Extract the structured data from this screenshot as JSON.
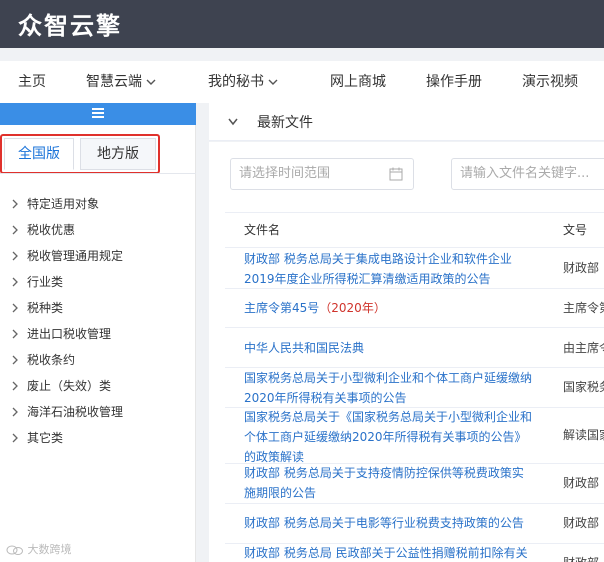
{
  "header": {
    "logo": "众智云擎"
  },
  "nav": {
    "items": [
      {
        "label": "主页"
      },
      {
        "label": "智慧云端"
      },
      {
        "label": "我的秘书"
      },
      {
        "label": "网上商城"
      },
      {
        "label": "操作手册"
      },
      {
        "label": "演示视频"
      }
    ]
  },
  "sidebar": {
    "tabs": [
      {
        "label": "全国版"
      },
      {
        "label": "地方版"
      }
    ],
    "tree": [
      {
        "label": "特定适用对象"
      },
      {
        "label": "税收优惠"
      },
      {
        "label": "税收管理通用规定"
      },
      {
        "label": "行业类"
      },
      {
        "label": "税种类"
      },
      {
        "label": "进出口税收管理"
      },
      {
        "label": "税收条约"
      },
      {
        "label": "废止（失效）类"
      },
      {
        "label": "海洋石油税收管理"
      },
      {
        "label": "其它类"
      }
    ]
  },
  "watermark": "大数跨境",
  "main": {
    "panel_title": "最新文件",
    "filters": {
      "date_placeholder": "请选择时间范围",
      "keyword_placeholder": "请输入文件名关键字..."
    },
    "table": {
      "columns": {
        "name": "文件名",
        "number": "文号"
      },
      "rows": [
        {
          "name": "财政部 税务总局关于集成电路设计企业和软件企业2019年度企业所得税汇算清缴适用政策的公告",
          "number": "财政部"
        },
        {
          "name": "主席令第45号",
          "name_suffix": "（2020年）",
          "number": "主席令第"
        },
        {
          "name": "中华人民共和国民法典",
          "number": "由主席令"
        },
        {
          "name": "国家税务总局关于小型微利企业和个体工商户延缓缴纳2020年所得税有关事项的公告",
          "number": "国家税务"
        },
        {
          "name": "国家税务总局关于《国家税务总局关于小型微利企业和个体工商户延缓缴纳2020年所得税有关事项的公告》的政策解读",
          "number": "解读国家"
        },
        {
          "name": "财政部 税务总局关于支持疫情防控保供等税费政策实施期限的公告",
          "number": "财政部"
        },
        {
          "name": "财政部 税务总局关于电影等行业税费支持政策的公告",
          "number": "财政部"
        },
        {
          "name": "财政部 税务总局 民政部关于公益性捐赠税前扣除有关",
          "number": "财政部"
        }
      ]
    }
  }
}
